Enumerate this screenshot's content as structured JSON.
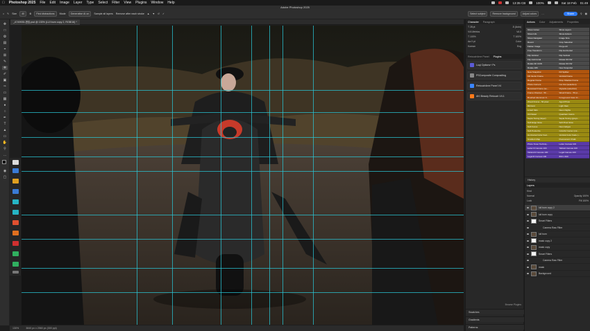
{
  "menubar": {
    "app": "Photoshop 2025",
    "items": [
      "File",
      "Edit",
      "Image",
      "Layer",
      "Type",
      "Select",
      "Filter",
      "View",
      "Plugins",
      "Window",
      "Help"
    ],
    "clock": "13:35 CB",
    "battery": "100%",
    "date": "Sat 18 Feb",
    "time": "01:49"
  },
  "window_title": "Adobe Photoshop 2025",
  "options": {
    "size": "Size",
    "more_detections": "Find distractions",
    "mode_label": "Mode",
    "mode_value": "Generative AI on",
    "sample_all": "Sample all layers",
    "remove_after": "Remove after each stroke",
    "select_subject": "Select subject",
    "remove_background": "Remove background",
    "adjust_colors": "Adjust colors",
    "share": "Share"
  },
  "doc_tab": "_A749935-편집.psd @ 130% (LUI burn copy 2, RGB/16) *",
  "status": {
    "zoom": "130%",
    "doc_info": "3840 px x 2560 px (300 ppi)"
  },
  "guides_v": [
    26,
    34,
    45,
    52,
    56,
    59,
    66
  ],
  "guides_h": [
    27.5,
    34.5,
    42,
    48,
    52.5,
    66,
    73.5,
    82.5,
    90
  ],
  "character_tabs": [
    "Character",
    "Paragraph"
  ],
  "character_rows": [
    [
      "T 28 pt",
      "Ä (Auto)"
    ],
    [
      "V/A Metrics",
      "VA 0"
    ],
    [
      "T 100%",
      "T 100%"
    ],
    [
      "Aa 0 pt",
      "Color"
    ],
    [
      "Korean",
      "Eng"
    ]
  ],
  "plugins_tabs": [
    "Retouch4me Panel",
    "Plugins"
  ],
  "plugins": [
    {
      "name": "Luqi Options+ Ps",
      "color": "#5b5bd6"
    },
    {
      "name": "PSComposite Compositing",
      "color": "#888888"
    },
    {
      "name": "Retouch4me Panel V4",
      "color": "#3a86ff"
    },
    {
      "name": "AKI Beauty Retouch V4.1",
      "color": "#ff7a1a"
    }
  ],
  "browse_plugins": "Browse Plugins",
  "swatches": "Swatches",
  "gradients": "Gradients",
  "patterns": "Patterns",
  "right_tabs": [
    "Actions",
    "Color",
    "Adjustments",
    "Properties"
  ],
  "actions": [
    [
      "Show Colour",
      "Show Layers",
      "#4a4a4a"
    ],
    [
      "Show Info",
      "Show Actions",
      "#4a4a4a"
    ],
    [
      "Show Navigator",
      "Image Size",
      "#4a4a4a"
    ],
    [
      "Revert",
      "Crop Selection",
      "#4a4a4a"
    ],
    [
      "Flatten Image",
      "Purge All",
      "#4a4a4a"
    ],
    [
      "Free Transform",
      "Flip Horizontal",
      "#4a4a4a"
    ],
    [
      "Flip Vertical",
      "Flip Vertical",
      "#4a4a4a"
    ],
    [
      "Flip Horizontal",
      "Rotate 90 CW",
      "#4a4a4a"
    ],
    [
      "Rotate 90 CCW",
      "Rotate 90 CW",
      "#4a4a4a"
    ],
    [
      "Rotate 180",
      "New Snapshot",
      "#4a4a4a"
    ],
    [
      "New Snapshot",
      "Kill Splitter",
      "#b0550e"
    ],
    [
      "Kill Vector Frame",
      "Vertical Frame",
      "#b0550e"
    ],
    [
      "Regular Frame",
      "Drop Shadow Frame",
      "#b0550e"
    ],
    [
      "Photo Corners",
      "Cut Out (selection)",
      "#b0550e"
    ],
    [
      "Recessed Frame (se...",
      "Vignette (selection)",
      "#b0550e"
    ],
    [
      "Frame Channel - 50 ...",
      "Wood Frame - 50 pi...",
      "#b0550e"
    ],
    [
      "Brushed Aluminum F...",
      "Foreground Color Fr...",
      "#b0550e"
    ],
    [
      "Wood Frame - 50 pixel",
      "Aged Photo",
      "#9a8a12"
    ],
    [
      "Blizzard",
      "Light Rain",
      "#9a8a12"
    ],
    [
      "Lizard Skin",
      "Neon Nights",
      "#9a8a12"
    ],
    [
      "Oil Pastel",
      "Quadrant Colors",
      "#9a8a12"
    ],
    [
      "Sepia Toning (layer)",
      "Sepia Toning (grays...",
      "#9a8a12"
    ],
    [
      "Soft Edge Glow",
      "Soft Pixel Glow",
      "#9a8a12"
    ],
    [
      "Soft Focus",
      "Neon Edges",
      "#9a8a12"
    ],
    [
      "Soft Posterize",
      "Colorful Center (col...",
      "#9a8a12"
    ],
    [
      "Horizontal Color Fad...",
      "Vertical Color Fade (...",
      "#9a8a12"
    ],
    [
      "Gradient Map",
      "Fluorescent Chalk",
      "#9a8a12"
    ],
    [
      "Photo Toner Techniq...",
      "Letter Canvas 100",
      "#5a3aa8"
    ],
    [
      "Letter R Canvas 100",
      "Tabloid Canvas 100",
      "#5a3aa8"
    ],
    [
      "Tabloid R Canvas 100",
      "Legal Canvas 100",
      "#5a3aa8"
    ],
    [
      "Legal R Canvas 100",
      "800 x 600",
      "#5a3aa8"
    ]
  ],
  "history": "History",
  "layers_tabs": [
    "Layers"
  ],
  "layers_kind": "Kind",
  "layers_blend": "Normal",
  "layers_opacity": "Opacity 100%",
  "layers_lock": "Lock",
  "layers_fill": "Fill 100%",
  "layers": [
    {
      "name": "lull burn copy 2",
      "sel": true,
      "thumb": "d"
    },
    {
      "name": "lull burn copy",
      "sel": false,
      "thumb": "d"
    },
    {
      "name": "Smart Filters",
      "sel": false,
      "thumb": "w"
    },
    {
      "name": "Camera Raw Filter",
      "sel": false,
      "thumb": "n"
    },
    {
      "name": "lull burn",
      "sel": false,
      "thumb": "d"
    },
    {
      "name": "mask copy 2",
      "sel": false,
      "thumb": "w"
    },
    {
      "name": "mask copy",
      "sel": false,
      "thumb": "d"
    },
    {
      "name": "Smart Filters",
      "sel": false,
      "thumb": "w"
    },
    {
      "name": "Camera Raw Filter",
      "sel": false,
      "thumb": "n"
    },
    {
      "name": "mask",
      "sel": false,
      "thumb": "d"
    },
    {
      "name": "Background",
      "sel": false,
      "thumb": "d"
    }
  ]
}
